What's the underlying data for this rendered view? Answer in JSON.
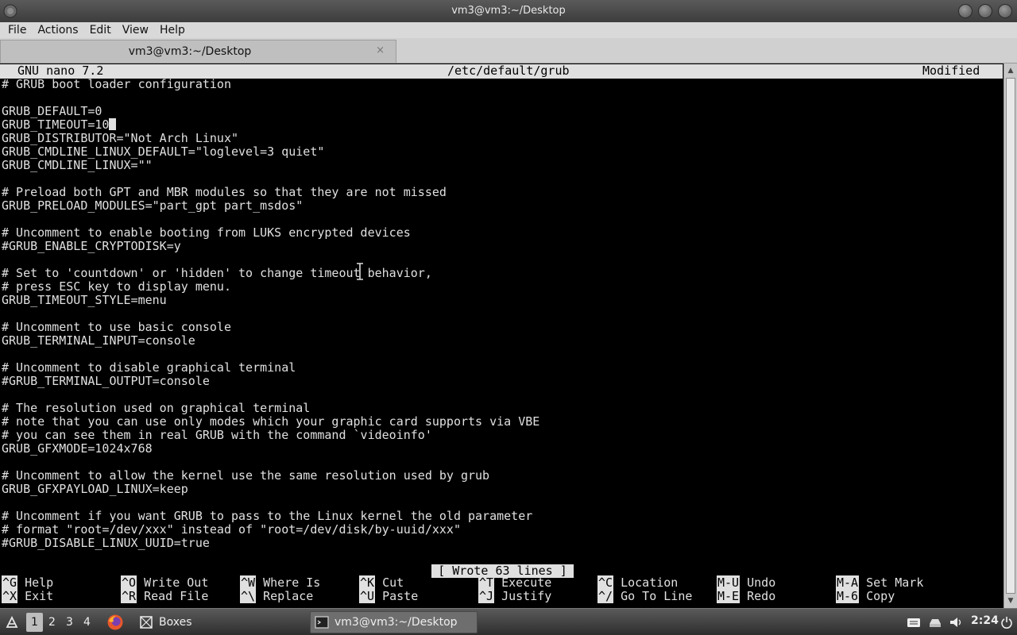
{
  "window": {
    "title": "vm3@vm3:~/Desktop"
  },
  "menubar": {
    "items": [
      "File",
      "Actions",
      "Edit",
      "View",
      "Help"
    ]
  },
  "tab": {
    "label": "vm3@vm3:~/Desktop",
    "close": "×"
  },
  "nano": {
    "version": "GNU nano 7.2",
    "filename": "/etc/default/grub",
    "state": "Modified",
    "lines": [
      "# GRUB boot loader configuration",
      "",
      "GRUB_DEFAULT=0",
      "GRUB_TIMEOUT=10",
      "GRUB_DISTRIBUTOR=\"Not Arch Linux\"",
      "GRUB_CMDLINE_LINUX_DEFAULT=\"loglevel=3 quiet\"",
      "GRUB_CMDLINE_LINUX=\"\"",
      "",
      "# Preload both GPT and MBR modules so that they are not missed",
      "GRUB_PRELOAD_MODULES=\"part_gpt part_msdos\"",
      "",
      "# Uncomment to enable booting from LUKS encrypted devices",
      "#GRUB_ENABLE_CRYPTODISK=y",
      "",
      "# Set to 'countdown' or 'hidden' to change timeout behavior,",
      "# press ESC key to display menu.",
      "GRUB_TIMEOUT_STYLE=menu",
      "",
      "# Uncomment to use basic console",
      "GRUB_TERMINAL_INPUT=console",
      "",
      "# Uncomment to disable graphical terminal",
      "#GRUB_TERMINAL_OUTPUT=console",
      "",
      "# The resolution used on graphical terminal",
      "# note that you can use only modes which your graphic card supports via VBE",
      "# you can see them in real GRUB with the command `videoinfo'",
      "GRUB_GFXMODE=1024x768",
      "",
      "# Uncomment to allow the kernel use the same resolution used by grub",
      "GRUB_GFXPAYLOAD_LINUX=keep",
      "",
      "# Uncomment if you want GRUB to pass to the Linux kernel the old parameter",
      "# format \"root=/dev/xxx\" instead of \"root=/dev/disk/by-uuid/xxx\"",
      "#GRUB_DISABLE_LINUX_UUID=true"
    ],
    "status_message": "[ Wrote 63 lines ]",
    "shortcuts": [
      [
        {
          "key": "^G",
          "label": "Help"
        },
        {
          "key": "^O",
          "label": "Write Out"
        },
        {
          "key": "^W",
          "label": "Where Is"
        },
        {
          "key": "^K",
          "label": "Cut"
        },
        {
          "key": "^T",
          "label": "Execute"
        },
        {
          "key": "^C",
          "label": "Location"
        },
        {
          "key": "M-U",
          "label": "Undo"
        },
        {
          "key": "M-A",
          "label": "Set Mark"
        }
      ],
      [
        {
          "key": "^X",
          "label": "Exit"
        },
        {
          "key": "^R",
          "label": "Read File"
        },
        {
          "key": "^\\",
          "label": "Replace"
        },
        {
          "key": "^U",
          "label": "Paste"
        },
        {
          "key": "^J",
          "label": "Justify"
        },
        {
          "key": "^/",
          "label": "Go To Line"
        },
        {
          "key": "M-E",
          "label": "Redo"
        },
        {
          "key": "M-6",
          "label": "Copy"
        }
      ]
    ]
  },
  "taskbar": {
    "workspaces": [
      "1",
      "2",
      "3",
      "4"
    ],
    "active_workspace": "1",
    "tasks": [
      {
        "label": "Boxes",
        "icon": "boxes-icon"
      },
      {
        "label": "vm3@vm3:~/Desktop",
        "icon": "terminal-icon"
      }
    ],
    "clock": "2:24"
  }
}
